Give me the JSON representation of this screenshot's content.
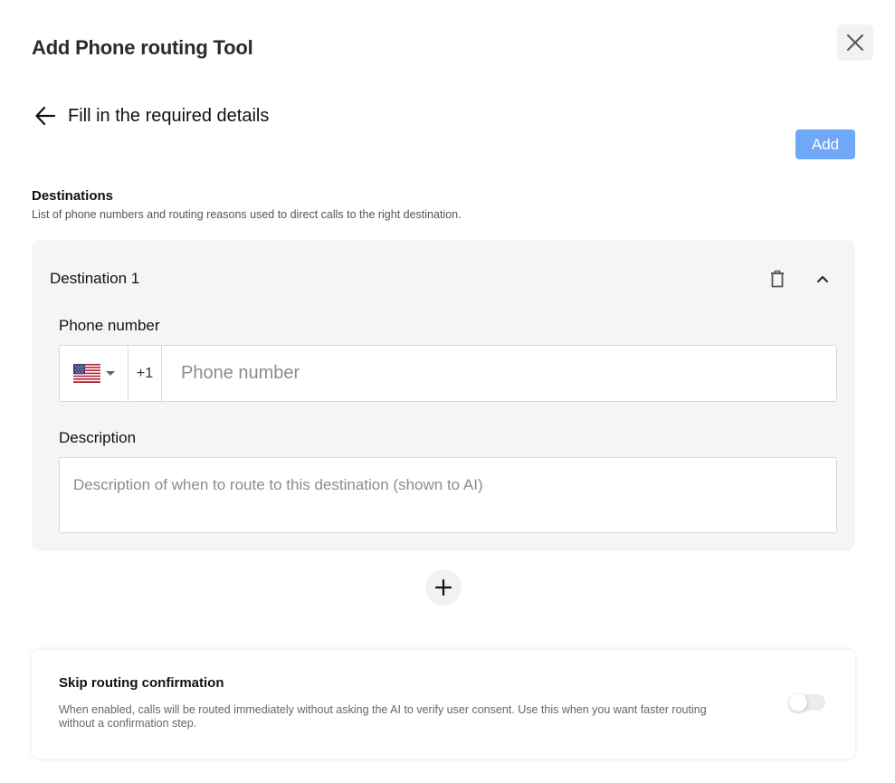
{
  "modal": {
    "title": "Add Phone routing Tool",
    "close_icon": "close-icon"
  },
  "step": {
    "back_icon": "arrow-left-icon",
    "title": "Fill in the required details"
  },
  "actions": {
    "add_label": "Add",
    "add_color": "#6ea8f7"
  },
  "destinations": {
    "label": "Destinations",
    "description": "List of phone numbers and routing reasons used to direct calls to the right destination.",
    "items": [
      {
        "title": "Destination 1",
        "delete_icon": "trash-icon",
        "collapse_icon": "chevron-up-icon",
        "phone_label": "Phone number",
        "country_flag": "us-flag-icon",
        "dial_code": "+1",
        "phone_value": "",
        "phone_placeholder": "Phone number",
        "description_label": "Description",
        "description_value": "",
        "description_placeholder": "Description of when to route to this destination (shown to AI)"
      }
    ],
    "add_icon": "plus-icon"
  },
  "skip_confirmation": {
    "title": "Skip routing confirmation",
    "description": "When enabled, calls will be routed immediately without asking the AI to verify user consent. Use this when you want faster routing without a confirmation step.",
    "enabled": false
  }
}
